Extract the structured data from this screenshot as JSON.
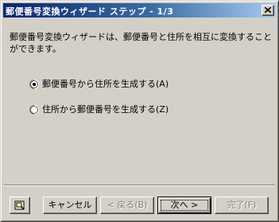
{
  "window": {
    "title": "郵便番号変換ウィザード ステップ - 1/3",
    "close_label": "×"
  },
  "description": "郵便番号変換ウィザードは、郵便番号と住所を相互に変換することができます。",
  "options": [
    {
      "label": "郵便番号から住所を生成する(A)",
      "selected": true
    },
    {
      "label": "住所から郵便番号を生成する(Z)",
      "selected": false
    }
  ],
  "buttons": {
    "help_icon": "help-icon",
    "cancel": "キャンセル",
    "back": "< 戻る(B)",
    "next": "次へ >",
    "finish": "完了(F)"
  },
  "colors": {
    "title_gradient_start": "#0a246a",
    "title_gradient_end": "#a6caf0",
    "face": "#d4d0c8"
  }
}
